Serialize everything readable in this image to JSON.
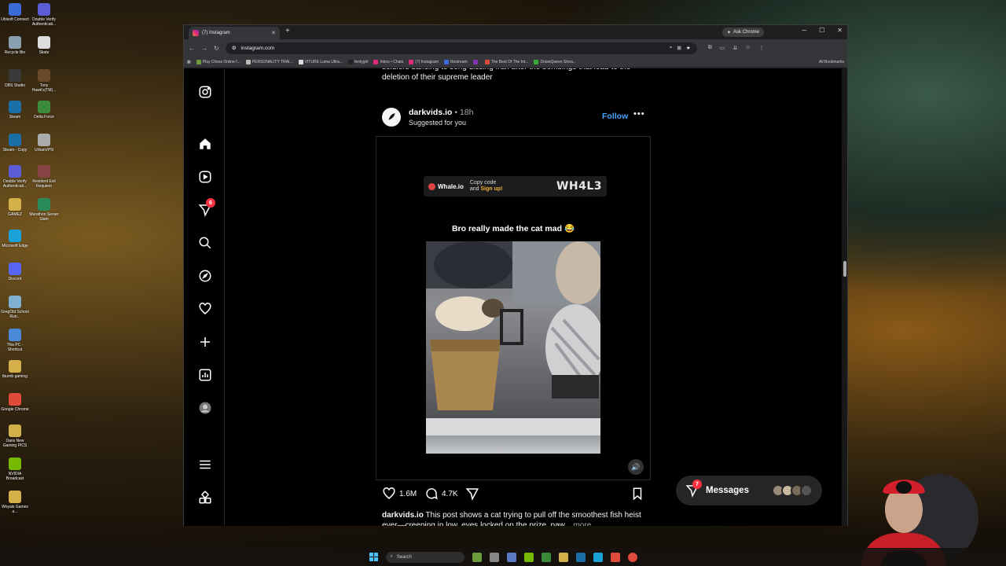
{
  "desktop": {
    "icons": [
      {
        "label": "Ubisoft Connect",
        "color": "#3a6bd6"
      },
      {
        "label": "Double Verify Authenticati...",
        "color": "#5c5cd6"
      },
      {
        "label": "Recycle Bin",
        "color": "#8aa0b0"
      },
      {
        "label": "Skate",
        "color": "#dddddd"
      },
      {
        "label": "OBS Studio",
        "color": "#3a3a3a"
      },
      {
        "label": "Tony Hawk's(TM)...",
        "color": "#6a4a2a"
      },
      {
        "label": "Steam",
        "color": "#1b6fa6"
      },
      {
        "label": "Delta Force",
        "color": "#3a8a3a"
      },
      {
        "label": "Steam - Copy",
        "color": "#1b6fa6"
      },
      {
        "label": "UrbanVPN",
        "color": "#aaaaaa"
      },
      {
        "label": "Double Verify Authenticati...",
        "color": "#5c5cd6"
      },
      {
        "label": "Resident Evil Requiem",
        "color": "#884444"
      },
      {
        "label": "GAMEZ",
        "color": "#d4b04a"
      },
      {
        "label": "Marathon Server Slam",
        "color": "#2a8a5a"
      },
      {
        "label": "Microsoft Edge",
        "color": "#1aa1d6"
      },
      {
        "label": "Discord",
        "color": "#5865f2"
      },
      {
        "label": "GregOld School Run...",
        "color": "#7fb0d0"
      },
      {
        "label": "This PC - Shortcut",
        "color": "#4a8ad6"
      },
      {
        "label": "tburnb gaming",
        "color": "#d4b04a"
      },
      {
        "label": "Google Chrome",
        "color": "#e04a3a"
      },
      {
        "label": "Dans New Gaming PICS",
        "color": "#d4b04a"
      },
      {
        "label": "NVIDIA Broadcast",
        "color": "#76b900"
      },
      {
        "label": "Woyals Games a...",
        "color": "#d4b04a"
      }
    ]
  },
  "browser": {
    "tab_title": "(7) Instagram",
    "tab_close": "✕",
    "new_tab": "+",
    "ask_chrome": "Ask Chrome",
    "url": "instagram.com",
    "bookmarks": [
      {
        "label": "Play Chess Online f...",
        "color": "#6a9a3a"
      },
      {
        "label": "PERSONALITY TRAI...",
        "color": "#bbbbbb"
      },
      {
        "label": "VITURE Luma Ultra...",
        "color": "#dddddd"
      },
      {
        "label": "fentygirl",
        "color": "#222222"
      },
      {
        "label": "Inbox • Chats",
        "color": "#dd2a7b"
      },
      {
        "label": "(7) Instagram",
        "color": "#dd2a7b"
      },
      {
        "label": "Restream",
        "color": "#3a6bd6"
      },
      {
        "label": "",
        "color": "#8134af"
      },
      {
        "label": "The Best Of The Int...",
        "color": "#e04a3a"
      },
      {
        "label": "DolanQueen Strea...",
        "color": "#3aaa3a"
      }
    ],
    "all_bookmarks": "All Bookmarks"
  },
  "instagram": {
    "sidebar_badge": "6",
    "prev_caption": "soldiers dancing to song dissing Iran after the bombings that lead to the deletion of their supreme leader",
    "post": {
      "author": "darkvids.io",
      "time": " • 18h",
      "suggested": "Suggested for you",
      "follow": "Follow",
      "more": "•••",
      "promo": {
        "brand": "Whale.io",
        "line1": "Copy code",
        "line2_prefix": "and ",
        "line2_highlight": "Sign up!",
        "code": "WH4L3"
      },
      "video_caption": "Bro really made the cat mad 😂",
      "likes": "1.6M",
      "comments": "4.7K",
      "caption_author": "darkvids.io",
      "caption_text": " This post shows a cat trying to pull off the smoothest fish heist ever—creeping in low, eyes locked on the prize, paw...",
      "caption_more": " more"
    },
    "messages": {
      "label": "Messages",
      "badge": "7"
    }
  },
  "taskbar": {
    "search": "Search"
  }
}
